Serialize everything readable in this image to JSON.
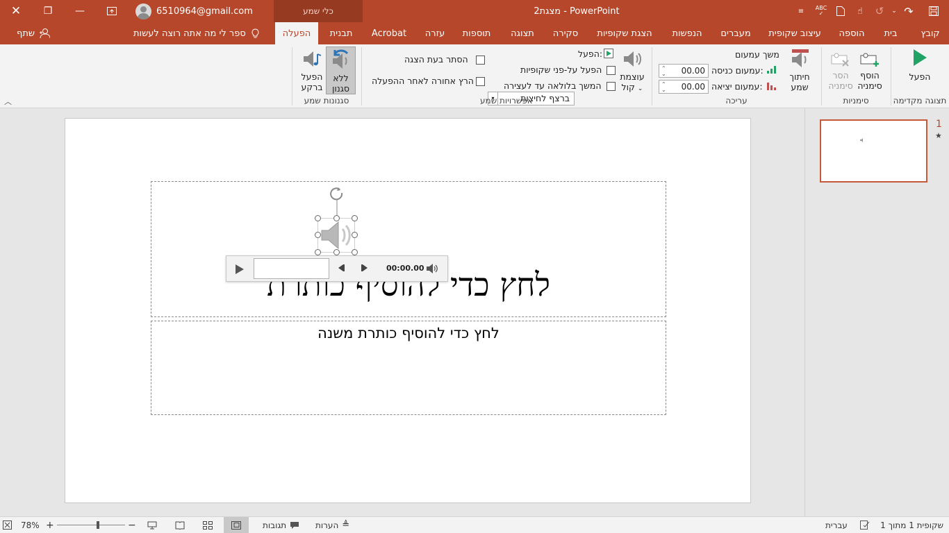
{
  "titlebar": {
    "account_email": "6510964@gmail.com",
    "contextual_header": "כלי שמע",
    "doc_title": "מצגת2  -  PowerPoint"
  },
  "tabs": [
    {
      "label": "קובץ",
      "key": "file"
    },
    {
      "label": "בית",
      "key": "home"
    },
    {
      "label": "הוספה",
      "key": "insert"
    },
    {
      "label": "עיצוב שקופית",
      "key": "design"
    },
    {
      "label": "מעברים",
      "key": "transitions"
    },
    {
      "label": "הנפשות",
      "key": "animations"
    },
    {
      "label": "הצגת שקופיות",
      "key": "slideshow"
    },
    {
      "label": "סקירה",
      "key": "review"
    },
    {
      "label": "תצוגה",
      "key": "view"
    },
    {
      "label": "תוספות",
      "key": "addins"
    },
    {
      "label": "עזרה",
      "key": "help"
    },
    {
      "label": "Acrobat",
      "key": "acrobat"
    },
    {
      "label": "תבנית",
      "key": "format"
    },
    {
      "label": "הפעלה",
      "key": "playback"
    }
  ],
  "tell_me": "ספר לי מה אתה רוצה לעשות",
  "share": "שתף",
  "ribbon": {
    "preview": {
      "play": "הפעל",
      "group": "תצוגה מקדימה"
    },
    "bookmarks": {
      "add_line1": "הוסף",
      "add_line2": "סימניה",
      "remove_line1": "הסר",
      "remove_line2": "סימניה",
      "group": "סימניות"
    },
    "editing": {
      "trim_line1": "חיתוך",
      "trim_line2": "שמע",
      "fade_duration": "משך עמעום",
      "fade_in_label": "עמעום כניסה:",
      "fade_in_value": "00.00",
      "fade_out_label": "עמעום יציאה:",
      "fade_out_value": "00.00",
      "group": "עריכה"
    },
    "audio_options": {
      "volume_line1": "עוצמת",
      "volume_line2": "קול",
      "start_label": "הפעל:",
      "start_value": "ברצף לחיצות",
      "play_across": "הפעל על-פני שקופיות",
      "loop": "המשך בלולאה עד לעצירה",
      "hide": "הסתר בעת הצגה",
      "rewind": "הרץ אחורה לאחר ההפעלה",
      "group": "אפשרויות שמע"
    },
    "audio_styles": {
      "no_style_line1": "ללא",
      "no_style_line2": "סגנון",
      "play_bg_line1": "הפעל",
      "play_bg_line2": "ברקע",
      "group": "סגנונות שמע"
    }
  },
  "slide": {
    "title_placeholder": "לחץ כדי להוסיף כותרת",
    "subtitle_placeholder": "לחץ כדי להוסיף כותרת משנה",
    "player_time": "00:00.00"
  },
  "thumbnails": [
    {
      "number": "1",
      "star": "★"
    }
  ],
  "statusbar": {
    "slide_count": "שקופית 1 מתוך 1",
    "language": "עברית",
    "notes": "הערות",
    "comments": "תגובות",
    "zoom": "78%"
  },
  "colors": {
    "accent": "#b7472a",
    "ribbon_bg": "#f3f3f3",
    "workspace": "#e6e6e6"
  }
}
